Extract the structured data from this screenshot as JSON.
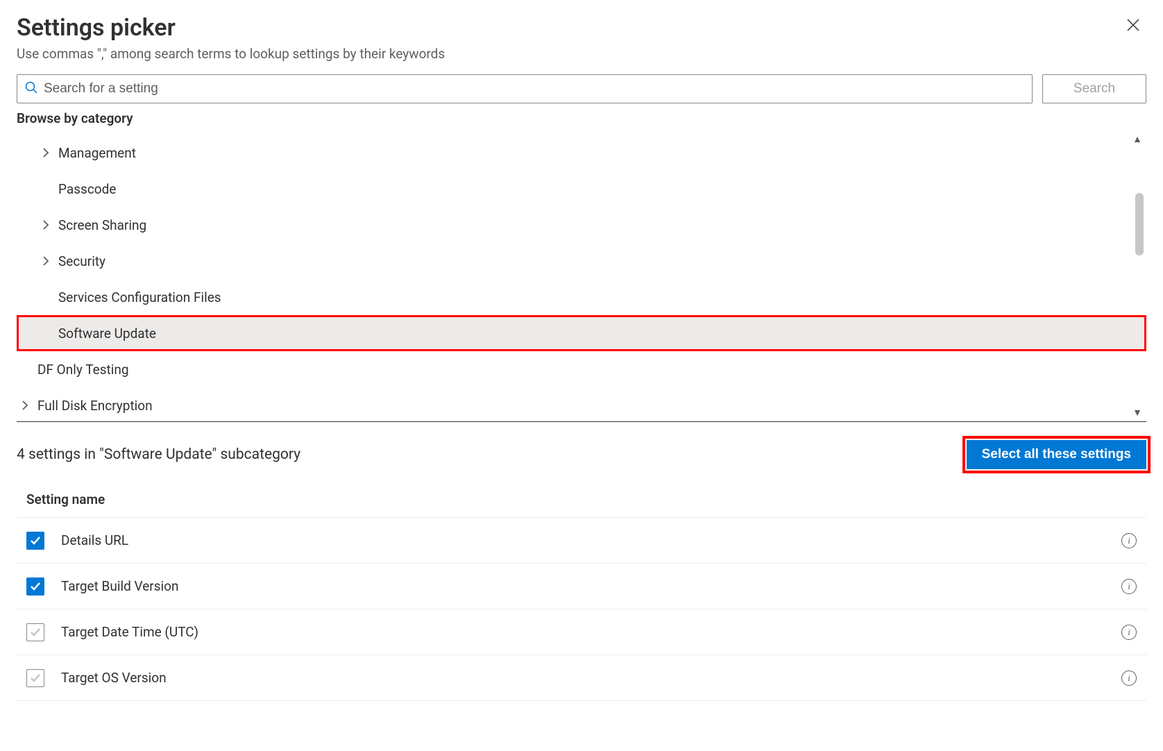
{
  "header": {
    "title": "Settings picker",
    "subtitle": "Use commas \",\" among search terms to lookup settings by their keywords"
  },
  "search": {
    "placeholder": "Search for a setting",
    "button_label": "Search"
  },
  "browse_label": "Browse by category",
  "categories": [
    {
      "label": "Management",
      "expandable": true,
      "indent": 1,
      "selected": false
    },
    {
      "label": "Passcode",
      "expandable": false,
      "indent": 1,
      "selected": false
    },
    {
      "label": "Screen Sharing",
      "expandable": true,
      "indent": 1,
      "selected": false
    },
    {
      "label": "Security",
      "expandable": true,
      "indent": 1,
      "selected": false
    },
    {
      "label": "Services Configuration Files",
      "expandable": false,
      "indent": 1,
      "selected": false
    },
    {
      "label": "Software Update",
      "expandable": false,
      "indent": 1,
      "selected": true,
      "highlighted": true
    },
    {
      "label": "DF Only Testing",
      "expandable": false,
      "indent": 0,
      "selected": false
    },
    {
      "label": "Full Disk Encryption",
      "expandable": true,
      "indent": 0,
      "selected": false
    }
  ],
  "subcategory": {
    "summary": "4 settings in \"Software Update\" subcategory",
    "select_all_label": "Select all these settings",
    "column_header": "Setting name"
  },
  "settings": [
    {
      "name": "Details URL",
      "checked": true
    },
    {
      "name": "Target Build Version",
      "checked": true
    },
    {
      "name": "Target Date Time (UTC)",
      "checked": false
    },
    {
      "name": "Target OS Version",
      "checked": false
    }
  ]
}
